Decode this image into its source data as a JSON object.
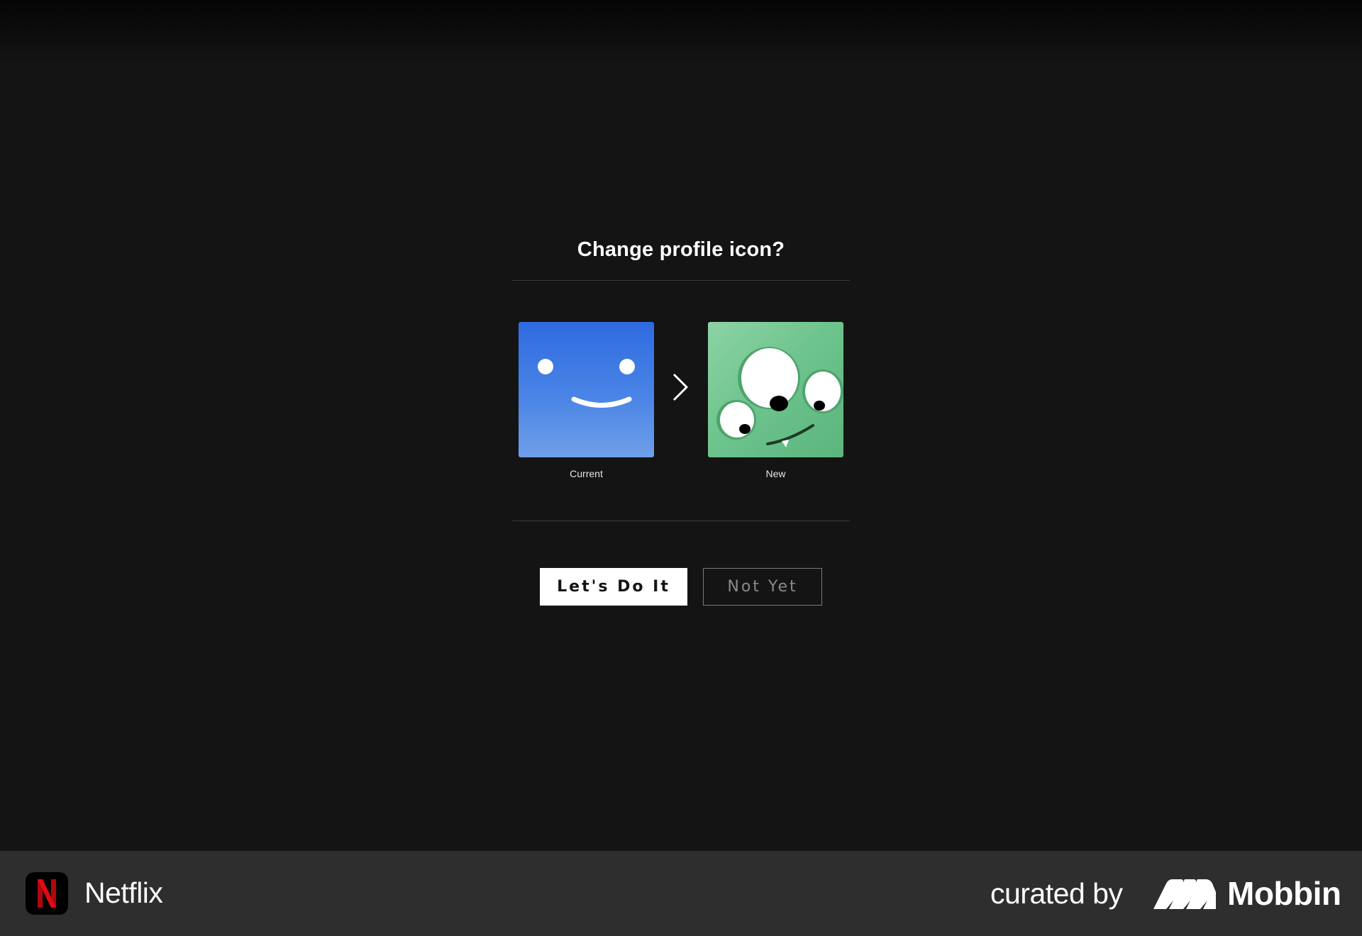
{
  "dialog": {
    "title": "Change profile icon?",
    "current_caption": "Current",
    "new_caption": "New",
    "current_avatar_icon": "smiley-face-avatar-icon",
    "new_avatar_icon": "three-eyed-monster-avatar-icon",
    "transition_icon": "chevron-right-icon"
  },
  "actions": {
    "confirm_label": "Let's Do It",
    "decline_label": "Not Yet"
  },
  "footer": {
    "app_name": "Netflix",
    "app_icon": "netflix-n-logo-icon",
    "curated_by_label": "curated by",
    "curator_name": "Mobbin",
    "curator_icon": "mobbin-logo-icon"
  },
  "colors": {
    "background": "#141414",
    "footer_background": "#2e2e2e",
    "brand_red": "#e50914",
    "current_avatar_blue": "#2f6be0",
    "new_avatar_green": "#6cc38c"
  }
}
